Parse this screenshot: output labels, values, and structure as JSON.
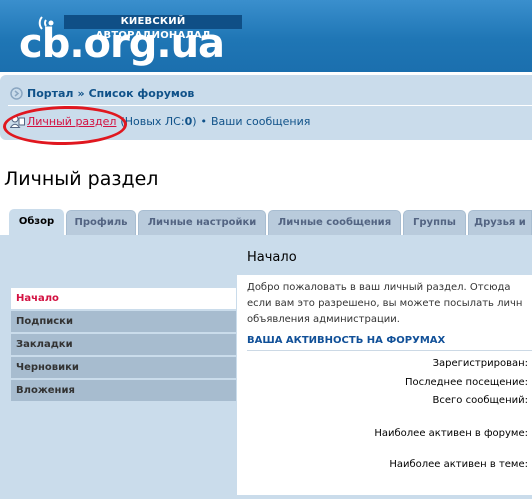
{
  "header": {
    "logo_tagline": "КИЕВСКИЙ АВТОРАДИОНАЛАЛ",
    "logo_text": "cb.org.ua",
    "colors": {
      "header_bg": "#1d74b3",
      "navbar_bg": "#cadceb",
      "link": "#105289",
      "active_link": "#d31141",
      "annotation_ring": "#e0171f"
    }
  },
  "breadcrumb": {
    "items": [
      "Портал",
      "Список форумов"
    ],
    "separator": "»"
  },
  "user_links": {
    "personal_section": "Личный раздел",
    "new_pm_prefix": "(Новых ЛС: ",
    "new_pm_count": "0",
    "new_pm_suffix": ")",
    "bullet": "•",
    "your_posts": "Ваши сообщения"
  },
  "page": {
    "title": "Личный раздел"
  },
  "tabs": [
    {
      "label": "Обзор",
      "active": true
    },
    {
      "label": "Профиль",
      "active": false
    },
    {
      "label": "Личные настройки",
      "active": false
    },
    {
      "label": "Личные сообщения",
      "active": false
    },
    {
      "label": "Группы",
      "active": false
    },
    {
      "label": "Друзья и",
      "active": false
    }
  ],
  "sidemenu": [
    {
      "label": "Начало",
      "active": true
    },
    {
      "label": "Подписки",
      "active": false
    },
    {
      "label": "Закладки",
      "active": false
    },
    {
      "label": "Черновики",
      "active": false
    },
    {
      "label": "Вложения",
      "active": false
    }
  ],
  "content": {
    "title": "Начало",
    "welcome_lines": [
      "Добро пожаловать в ваш личный раздел. Отсюда",
      "если вам это разрешено, вы можете посылать личн",
      "объявления администрации."
    ],
    "activity_title": "ВАША АКТИВНОСТЬ НА ФОРУМАХ",
    "stats": [
      {
        "label": "Зарегистрирован:"
      },
      {
        "label": "Последнее посещение:"
      },
      {
        "label": "Всего сообщений:"
      },
      {
        "label": "Наиболее активен в форуме:"
      },
      {
        "label": "Наиболее активен в теме:"
      }
    ]
  }
}
